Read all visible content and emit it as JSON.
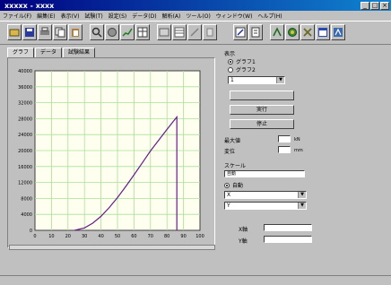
{
  "window": {
    "title": "xxxxx - xxxx",
    "buttons": [
      "_",
      "□",
      "×"
    ]
  },
  "menu": [
    "ファイル(F)",
    "編集(E)",
    "表示(V)",
    "試験(T)",
    "設定(S)",
    "データ(D)",
    "解析(A)",
    "ツール(O)",
    "ウィンドウ(W)",
    "ヘルプ(H)"
  ],
  "toolbar": {
    "buttons": [
      "open-icon",
      "save-icon",
      "print-icon",
      "copy-icon",
      "paste-icon",
      "zoom-icon",
      "measure-icon",
      "chart-icon",
      "table-icon",
      "edit-icon",
      "grid-icon",
      "run-icon",
      "report-icon",
      "pen-icon",
      "tool-icon",
      "calc-icon",
      "graph-icon",
      "exit-icon"
    ]
  },
  "tabs": [
    "グラフ",
    "データ",
    "試験結果"
  ],
  "right_panel": {
    "group_title": "表示",
    "radio": [
      {
        "label": "グラフ1",
        "checked": true
      },
      {
        "label": "グラフ2",
        "checked": false
      }
    ],
    "select_value": "1",
    "buttons": [
      {
        "label": "",
        "disabled": true
      },
      {
        "label": "実行",
        "disabled": false
      },
      {
        "label": "停止",
        "disabled": false
      }
    ],
    "fields": [
      {
        "label": "最大値",
        "value": "",
        "unit": "kN"
      },
      {
        "label": "変位",
        "value": "",
        "unit": "mm"
      }
    ],
    "scale_label": "スケール",
    "scale_value": "自動",
    "option_checkbox": "自動",
    "dropdown1": "X",
    "dropdown2": "Y",
    "bottom_fields": [
      {
        "label": "X軸",
        "value": ""
      },
      {
        "label": "Y軸",
        "value": ""
      }
    ]
  },
  "chart_data": {
    "type": "line",
    "title": "",
    "xlabel": "",
    "ylabel": "",
    "xlim": [
      0,
      100
    ],
    "ylim": [
      0,
      40000
    ],
    "grid": true,
    "x_ticks": [
      "0",
      "10",
      "20",
      "30",
      "40",
      "50",
      "60",
      "70",
      "80",
      "90",
      "100"
    ],
    "y_ticks": [
      "0",
      "4000",
      "8000",
      "12000",
      "16000",
      "20000",
      "24000",
      "28000",
      "32000",
      "36000",
      "40000"
    ],
    "series": [
      {
        "name": "",
        "color": "#6a1a8a",
        "x": [
          24,
          30,
          35,
          40,
          45,
          50,
          55,
          60,
          65,
          70,
          75,
          80,
          85,
          86,
          86
        ],
        "y": [
          0,
          600,
          1800,
          3500,
          5700,
          8200,
          11000,
          13900,
          16900,
          19900,
          22600,
          25300,
          27900,
          28400,
          0
        ]
      }
    ]
  }
}
